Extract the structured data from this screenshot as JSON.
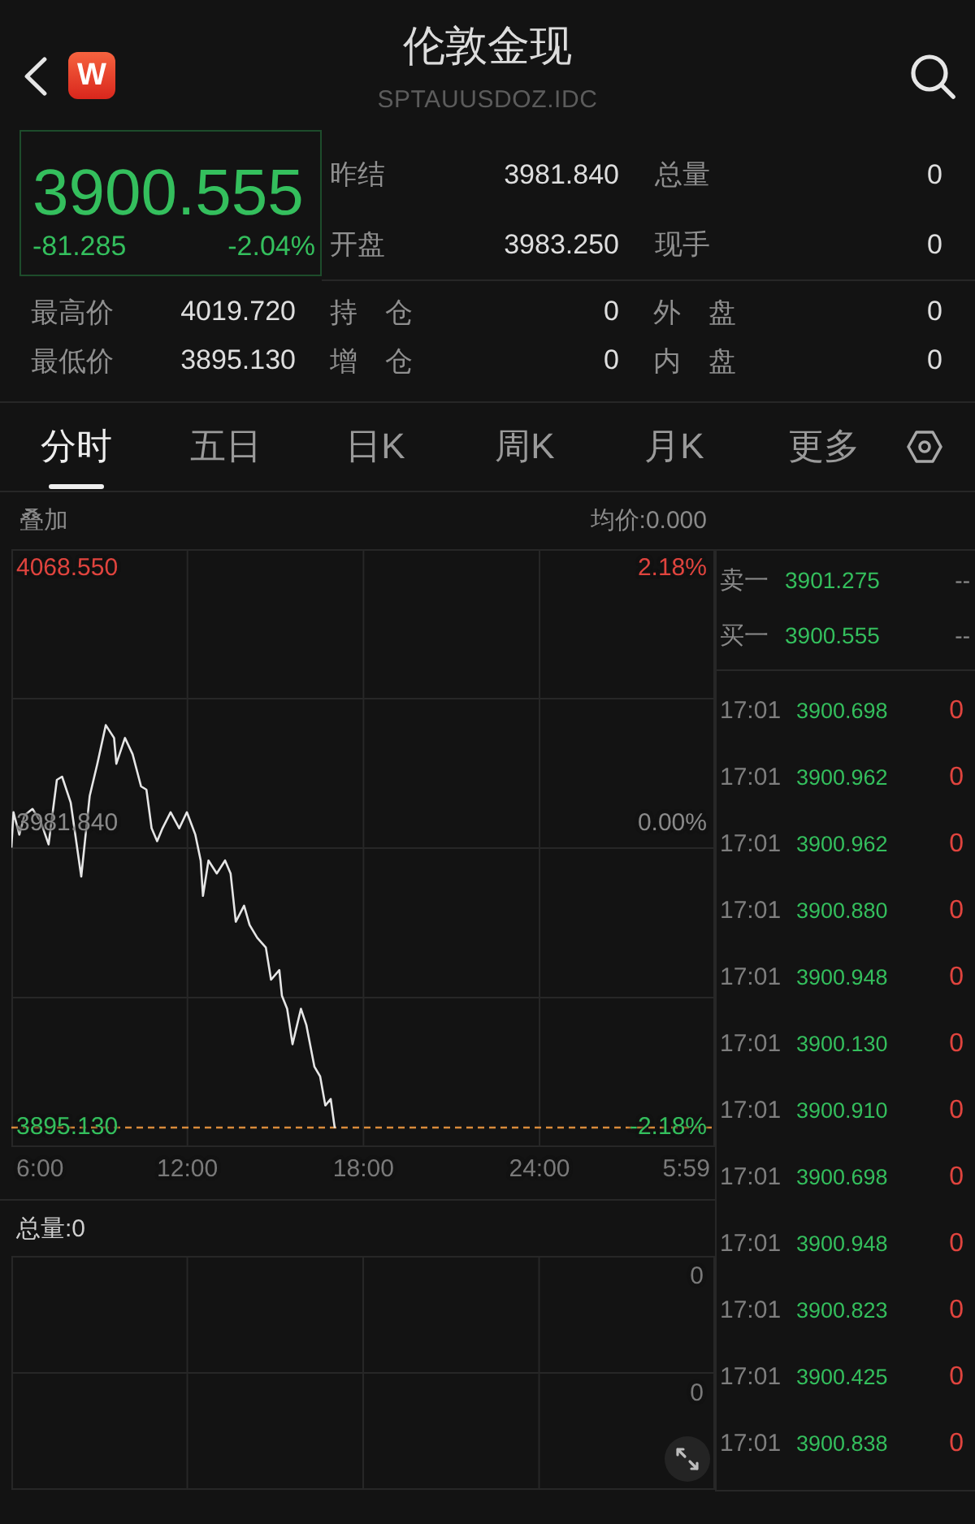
{
  "header": {
    "title": "伦敦金现",
    "code": "SPTAUUSDOZ.IDC",
    "logo_text": "W"
  },
  "quote": {
    "price": "3900.555",
    "change": "-81.285",
    "change_pct": "-2.04%",
    "falling": true,
    "stats": [
      {
        "label": "昨结",
        "value": "3981.840"
      },
      {
        "label": "总量",
        "value": "0"
      },
      {
        "label": "开盘",
        "value": "3983.250"
      },
      {
        "label": "现手",
        "value": "0"
      }
    ],
    "details": [
      {
        "label": "最高价",
        "value": "4019.720"
      },
      {
        "label": "持　仓",
        "value": "0"
      },
      {
        "label": "外　盘",
        "value": "0"
      },
      {
        "label": "最低价",
        "value": "3895.130"
      },
      {
        "label": "增　仓",
        "value": "0"
      },
      {
        "label": "内　盘",
        "value": "0"
      }
    ]
  },
  "tabs": [
    {
      "label": "分时",
      "selected": true
    },
    {
      "label": "五日",
      "selected": false
    },
    {
      "label": "日K",
      "selected": false
    },
    {
      "label": "周K",
      "selected": false
    },
    {
      "label": "月K",
      "selected": false
    },
    {
      "label": "更多",
      "selected": false
    }
  ],
  "intraday": {
    "overlay_label": "叠加",
    "avg_price": "均价:0.000",
    "ref_price_label": "3981.840",
    "percent_labels": [
      "2.18%",
      "0.00%",
      "-2.18%"
    ],
    "end_time_label": "5:59",
    "chart_data": {
      "type": "line",
      "grid": true,
      "x": [
        6,
        6.07,
        6.27,
        6.45,
        6.72,
        7,
        7.27,
        7.55,
        7.73,
        8.02,
        8.38,
        8.67,
        8.93,
        9.22,
        9.5,
        9.58,
        9.87,
        10.13,
        10.42,
        10.6,
        10.78,
        10.97,
        11.15,
        11.43,
        11.72,
        11.98,
        12.27,
        12.45,
        12.53,
        12.72,
        13,
        13.28,
        13.47,
        13.65,
        13.93,
        14.12,
        14.38,
        14.67,
        14.85,
        15.13,
        15.22,
        15.4,
        15.58,
        15.87,
        16.05,
        16.33,
        16.52,
        16.7,
        16.88,
        17.02
      ],
      "series": [
        {
          "color": "#e6e6e6",
          "values": [
            3982,
            3993,
            3986,
            3992,
            3994,
            3990,
            3983,
            4003,
            4004,
            3996,
            3973,
            3998,
            4008,
            4020,
            4016,
            4008,
            4016,
            4011,
            4001,
            4000,
            3988,
            3984,
            3988,
            3993,
            3988,
            3993,
            3986,
            3978,
            3967,
            3978,
            3974,
            3978,
            3974,
            3959,
            3964,
            3958,
            3954,
            3951,
            3941,
            3944,
            3936,
            3932,
            3921,
            3932,
            3927,
            3914,
            3911,
            3902,
            3904,
            3895
          ]
        }
      ],
      "ref_lines": [
        {
          "axis": "y",
          "value": 3895.13,
          "color": "#d98b3b"
        }
      ],
      "xlim": [
        6,
        29.98
      ],
      "ylim": [
        3889.08,
        4074.6
      ],
      "xticks": [
        {
          "value": 6,
          "label": "6:00"
        },
        {
          "value": 12,
          "label": "12:00"
        },
        {
          "value": 18,
          "label": "18:00"
        },
        {
          "value": 24,
          "label": "24:00"
        }
      ],
      "yticks": [
        {
          "value": 4068.55,
          "label": "4068.550"
        },
        {
          "value": 3895.13,
          "label": "3895.130"
        }
      ]
    }
  },
  "volume": {
    "total_label": "总量:0",
    "axis_labels": [
      "0",
      "0"
    ]
  },
  "order_book": [
    {
      "label": "卖一",
      "price": "3901.275",
      "volume": "--"
    },
    {
      "label": "买一",
      "price": "3900.555",
      "volume": "--"
    }
  ],
  "trades": [
    {
      "time": "17:01",
      "price": "3900.698",
      "volume": "0"
    },
    {
      "time": "17:01",
      "price": "3900.962",
      "volume": "0"
    },
    {
      "time": "17:01",
      "price": "3900.962",
      "volume": "0"
    },
    {
      "time": "17:01",
      "price": "3900.880",
      "volume": "0"
    },
    {
      "time": "17:01",
      "price": "3900.948",
      "volume": "0"
    },
    {
      "time": "17:01",
      "price": "3900.130",
      "volume": "0"
    },
    {
      "time": "17:01",
      "price": "3900.910",
      "volume": "0"
    },
    {
      "time": "17:01",
      "price": "3900.698",
      "volume": "0"
    },
    {
      "time": "17:01",
      "price": "3900.948",
      "volume": "0"
    },
    {
      "time": "17:01",
      "price": "3900.823",
      "volume": "0"
    },
    {
      "time": "17:01",
      "price": "3900.425",
      "volume": "0"
    },
    {
      "time": "17:01",
      "price": "3900.838",
      "volume": "0"
    }
  ]
}
